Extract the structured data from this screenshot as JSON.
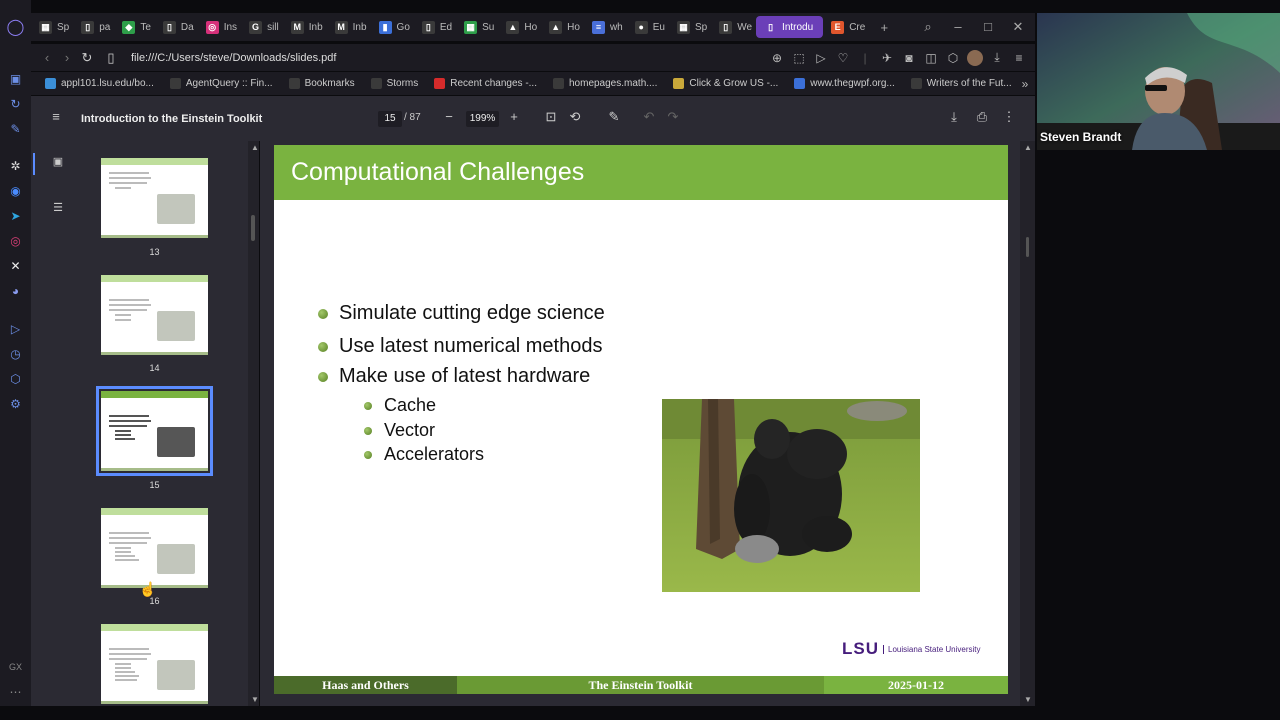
{
  "browser": {
    "tabs": [
      {
        "label": "Sp",
        "color": "#3a3a3a",
        "glyph": "▦"
      },
      {
        "label": "pa",
        "color": "#3a3a3a",
        "glyph": "▯"
      },
      {
        "label": "Te",
        "color": "#2e9e4a",
        "glyph": "◆"
      },
      {
        "label": "Da",
        "color": "#3a3a3a",
        "glyph": "▯"
      },
      {
        "label": "Ins",
        "color": "#d6307a",
        "glyph": "◎"
      },
      {
        "label": "sill",
        "color": "#3a3a3a",
        "glyph": "G"
      },
      {
        "label": "Inb",
        "color": "#3a3a3a",
        "glyph": "M"
      },
      {
        "label": "Inb",
        "color": "#3a3a3a",
        "glyph": "M"
      },
      {
        "label": "Go",
        "color": "#3b6fd8",
        "glyph": "▮"
      },
      {
        "label": "Ed",
        "color": "#3a3a3a",
        "glyph": "▯"
      },
      {
        "label": "Su",
        "color": "#2e9e4a",
        "glyph": "▦"
      },
      {
        "label": "Ho",
        "color": "#3a3a3a",
        "glyph": "▲"
      },
      {
        "label": "Ho",
        "color": "#3a3a3a",
        "glyph": "▲"
      },
      {
        "label": "wh",
        "color": "#4a6fd8",
        "glyph": "≡"
      },
      {
        "label": "Eu",
        "color": "#3a3a3a",
        "glyph": "●"
      },
      {
        "label": "Sp",
        "color": "#3a3a3a",
        "glyph": "▦"
      },
      {
        "label": "We",
        "color": "#3a3a3a",
        "glyph": "▯"
      },
      {
        "label": "Introdu",
        "color": "#6b3fb8",
        "glyph": "▯",
        "active": true
      },
      {
        "label": "Cre",
        "color": "#e0562d",
        "glyph": "E"
      }
    ],
    "url": "file:///C:/Users/steve/Downloads/slides.pdf",
    "bookmarks": [
      {
        "label": "appl101.lsu.edu/bo...",
        "color": "#3b8fd8"
      },
      {
        "label": "AgentQuery :: Fin...",
        "color": "#3a3a3a"
      },
      {
        "label": "Bookmarks",
        "color": "#3a3a3a"
      },
      {
        "label": "Storms",
        "color": "#3a3a3a"
      },
      {
        "label": "Recent changes -...",
        "color": "#d62b2b"
      },
      {
        "label": "homepages.math....",
        "color": "#3a3a3a"
      },
      {
        "label": "Click & Grow US -...",
        "color": "#c9a83a"
      },
      {
        "label": "www.thegwpf.org...",
        "color": "#3b6fd8"
      },
      {
        "label": "Writers of the Fut...",
        "color": "#3a3a3a"
      }
    ]
  },
  "pdf": {
    "title": "Introduction to the Einstein Toolkit",
    "page_current": "15",
    "page_total": "/ 87",
    "zoom": "199%"
  },
  "thumbnails": [
    {
      "num": "13",
      "selected": false
    },
    {
      "num": "14",
      "selected": false
    },
    {
      "num": "15",
      "selected": true
    },
    {
      "num": "16",
      "selected": false
    },
    {
      "num": "",
      "selected": false
    }
  ],
  "slide": {
    "title": "Computational Challenges",
    "bullets": [
      "Simulate cutting edge science",
      "Use latest numerical methods",
      "Make use of latest hardware"
    ],
    "sub_bullets": [
      "Cache",
      "Vector",
      "Accelerators"
    ],
    "logo_mark": "LSU",
    "logo_name": "Louisiana State University",
    "footer": {
      "left": "Haas and Others",
      "center": "The Einstein Toolkit",
      "right": "2025-01-12"
    },
    "colors": {
      "accent": "#7ab340",
      "footer_dark": "#4b6b2a",
      "footer_mid": "#7ab340"
    }
  },
  "webcam": {
    "name": "Steven Brandt"
  }
}
